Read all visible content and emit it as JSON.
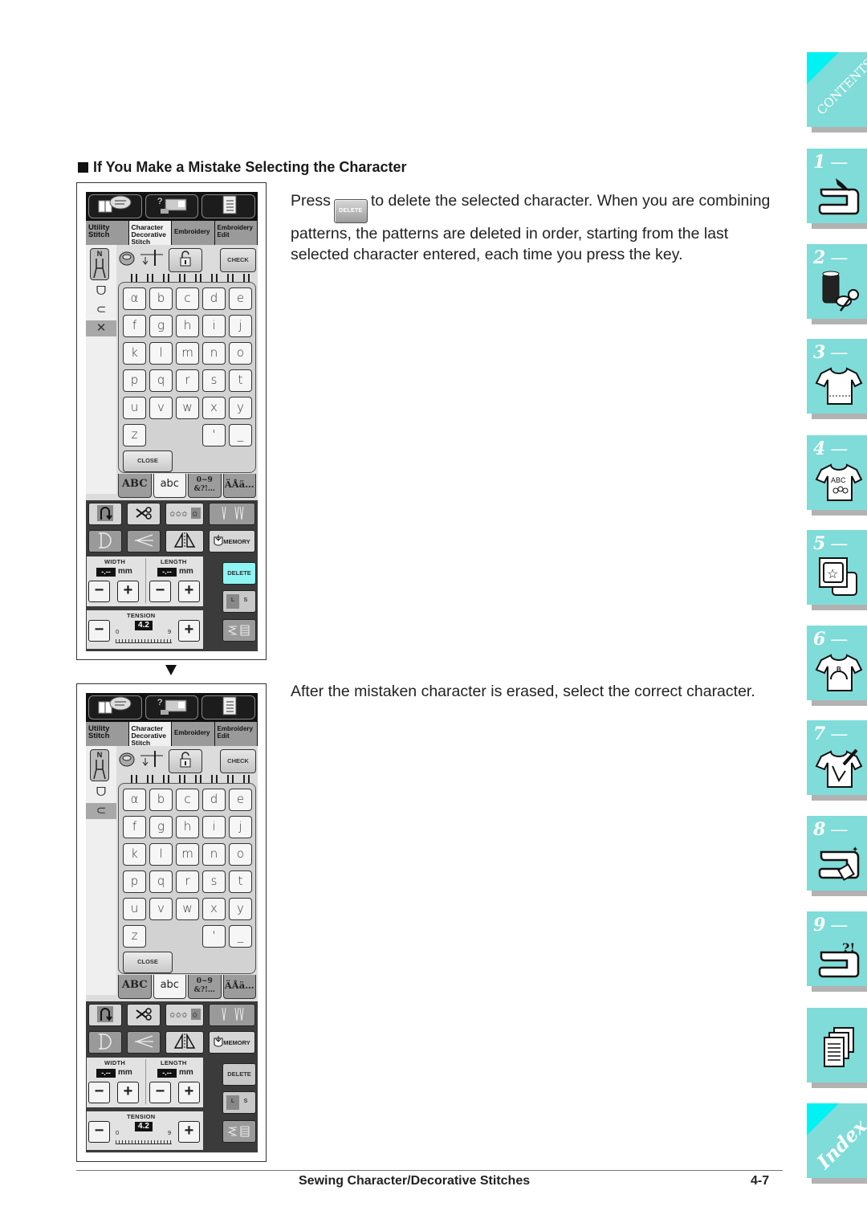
{
  "heading": "If You Make a Mistake Selecting the Character",
  "paragraph1": {
    "before_key": "Press",
    "key_label": "DELETE",
    "after_key": "to delete the selected character. When you are combining patterns, the patterns are deleted in order, starting from the last selected character entered, each time you press the key."
  },
  "paragraph2": "After the mistaken character is erased, select the correct character.",
  "screen": {
    "mode_tabs": [
      {
        "line1": "Utility",
        "line2": "Stitch",
        "line3": ""
      },
      {
        "line1": "Character",
        "line2": "Decorative",
        "line3": "Stitch"
      },
      {
        "line1": "Embroidery",
        "line2": "",
        "line3": ""
      },
      {
        "line1": "Embroidery",
        "line2": "Edit",
        "line3": ""
      }
    ],
    "foot_label": "N",
    "check_label": "CHECK",
    "keys": [
      "α",
      "b",
      "c",
      "d",
      "e",
      "f",
      "g",
      "h",
      "i",
      "j",
      "k",
      "l",
      "m",
      "n",
      "o",
      "p",
      "q",
      "r",
      "s",
      "t",
      "u",
      "v",
      "w",
      "x",
      "y",
      "z",
      "'",
      "_"
    ],
    "close_label": "CLOSE",
    "char_tabs": [
      "ABC",
      "abc",
      "0~9 &?!…",
      "ÄÅä…"
    ],
    "memory_label": "MEMORY",
    "width_label": "WIDTH",
    "length_label": "LENGTH",
    "width_value": "-.--",
    "length_value": "-.--",
    "unit": "mm",
    "tension_label": "TENSION",
    "tension_value": "4.2",
    "tension_min": "0",
    "tension_max": "9",
    "delete_label": "DELETE",
    "l_label": "L",
    "s_label": "S",
    "minus": "−",
    "plus": "+"
  },
  "screen1": {
    "side_icons": [
      "ᗜ",
      "⊂",
      "✕"
    ],
    "selected_side": 2,
    "delete_highlight": true
  },
  "screen2": {
    "side_icons": [
      "ᗜ",
      "⊂"
    ],
    "selected_side": 1,
    "delete_highlight": false
  },
  "footer": {
    "title": "Sewing Character/Decorative Stitches",
    "page": "4-7"
  },
  "side_tabs": [
    {
      "label": "CONTENTS",
      "type": "contents"
    },
    {
      "label": "1",
      "icon": "sewing-machine-hand-icon"
    },
    {
      "label": "2",
      "icon": "thread-spool-scissors-icon"
    },
    {
      "label": "3",
      "icon": "shirt-stitch-icon"
    },
    {
      "label": "4",
      "icon": "shirt-abc-icon"
    },
    {
      "label": "5",
      "icon": "embroidery-hoop-icon"
    },
    {
      "label": "6",
      "icon": "shirt-embroidery-icon"
    },
    {
      "label": "7",
      "icon": "shirt-edit-icon"
    },
    {
      "label": "8",
      "icon": "sewing-machine-maintenance-icon"
    },
    {
      "label": "9",
      "icon": "sewing-machine-troubleshoot-icon"
    },
    {
      "label": "",
      "icon": "documents-icon"
    },
    {
      "label": "Index",
      "type": "index"
    }
  ],
  "colors": {
    "tab": "#7fdcd8",
    "tab_corner": "#00f2f2",
    "delete_highlight": "#8ff4f4"
  }
}
